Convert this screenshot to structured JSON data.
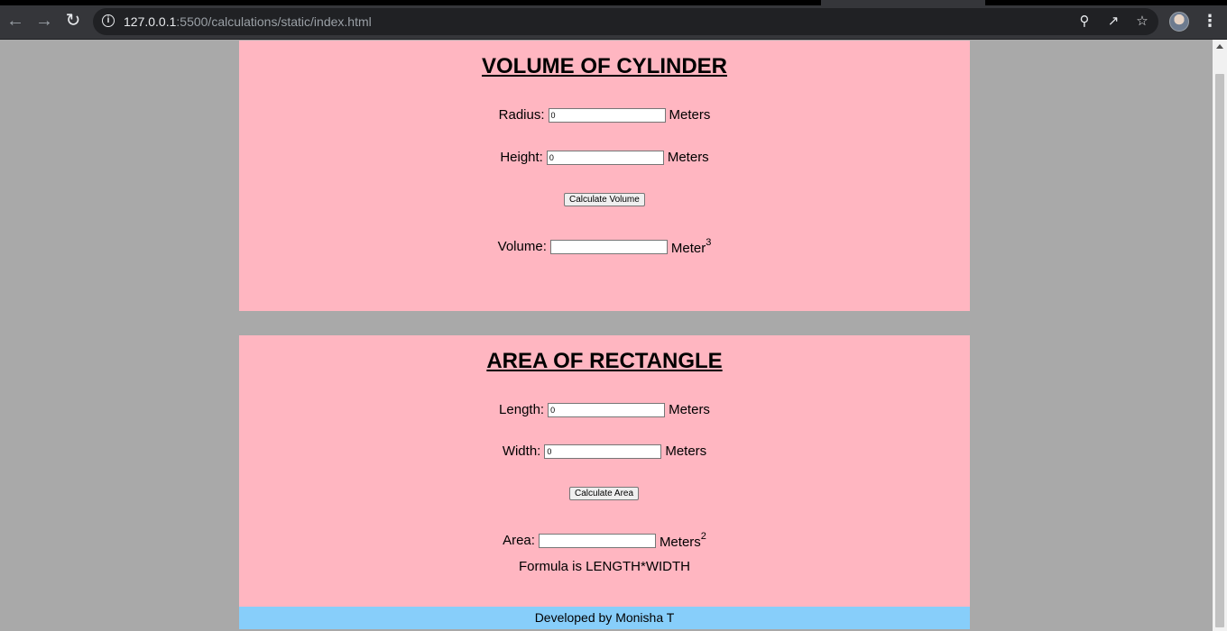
{
  "browser": {
    "url_host": "127.0.0.1",
    "url_path": ":5500/calculations/static/index.html"
  },
  "cylinder": {
    "title": "VOLUME OF CYLINDER",
    "radius_label": "Radius:",
    "radius_value": "0",
    "radius_unit": "Meters",
    "height_label": "Height:",
    "height_value": "0",
    "height_unit": "Meters",
    "button_label": "Calculate Volume",
    "volume_label": "Volume:",
    "volume_value": "",
    "volume_unit": "Meter",
    "volume_unit_exp": "3"
  },
  "rectangle": {
    "title": "AREA OF RECTANGLE",
    "length_label": "Length:",
    "length_value": "0",
    "length_unit": "Meters",
    "width_label": "Width:",
    "width_value": "0",
    "width_unit": "Meters",
    "button_label": "Calculate Area",
    "area_label": "Area:",
    "area_value": "",
    "area_unit": "Meters",
    "area_unit_exp": "2",
    "formula": "Formula is LENGTH*WIDTH"
  },
  "footer": {
    "text": "Developed by Monisha T"
  }
}
